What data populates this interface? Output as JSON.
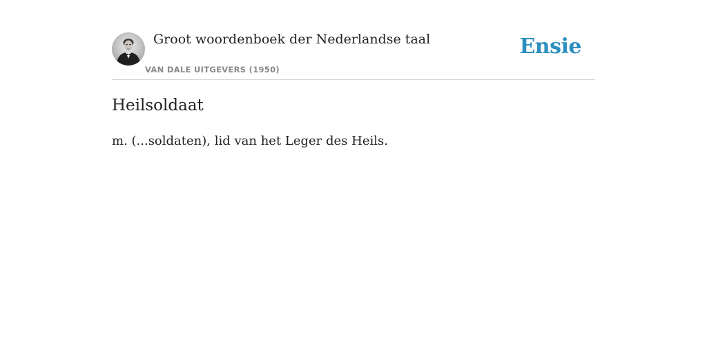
{
  "header": {
    "book_title": "Groot woordenboek der Nederlandse taal",
    "publisher": "VAN DALE UITGEVERS (1950)",
    "avatar_icon": "author-portrait",
    "logo_text": "Ensie",
    "logo_color": "#2c8fbf"
  },
  "entry": {
    "headword": "Heilsoldaat",
    "definition": "m. (...soldaten), lid van het Leger des Heils."
  }
}
